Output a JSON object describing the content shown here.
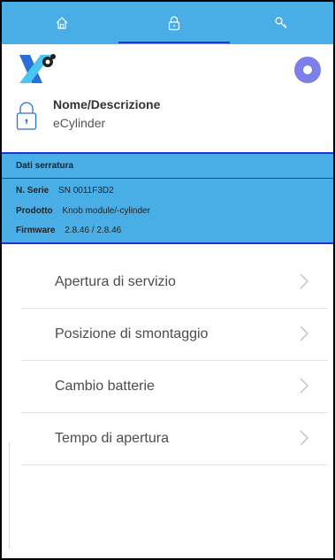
{
  "tabs": [
    {
      "name": "home",
      "icon": "home-icon"
    },
    {
      "name": "lock",
      "icon": "lock-icon",
      "active": true
    },
    {
      "name": "key",
      "icon": "key-icon"
    }
  ],
  "header": {
    "name_label": "Nome/Descrizione",
    "name_value": "eCylinder"
  },
  "lock_data": {
    "title": "Dati serratura",
    "rows": [
      {
        "key": "N. Serie",
        "value": "SN 0011F3D2"
      },
      {
        "key": "Prodotto",
        "value": "Knob module/-cylinder"
      },
      {
        "key": "Firmware",
        "value": "2.8.46 / 2.8.46"
      }
    ]
  },
  "menu": [
    {
      "label": "Apertura di servizio"
    },
    {
      "label": "Posizione di smontaggio"
    },
    {
      "label": "Cambio batterie"
    },
    {
      "label": "Tempo di apertura"
    }
  ],
  "colors": {
    "accent": "#4aaee6",
    "underline": "#2431d6",
    "circle_button": "#7b7fe7"
  }
}
